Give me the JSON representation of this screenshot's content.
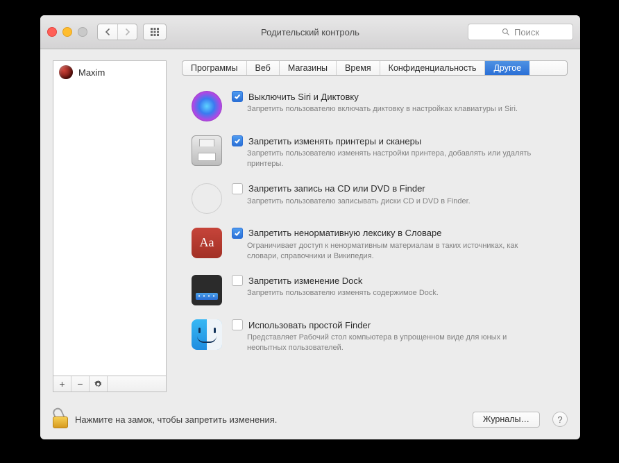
{
  "window": {
    "title": "Родительский контроль"
  },
  "toolbar": {
    "search_placeholder": "Поиск"
  },
  "sidebar": {
    "users": [
      {
        "name": "Maxim"
      }
    ],
    "add_label": "+",
    "remove_label": "−"
  },
  "tabs": {
    "items": [
      {
        "label": "Программы",
        "active": false
      },
      {
        "label": "Веб",
        "active": false
      },
      {
        "label": "Магазины",
        "active": false
      },
      {
        "label": "Время",
        "active": false
      },
      {
        "label": "Конфиденциальность",
        "active": false
      },
      {
        "label": "Другое",
        "active": true
      }
    ]
  },
  "options": [
    {
      "icon": "siri",
      "checked": true,
      "title": "Выключить Siri и Диктовку",
      "desc": "Запретить пользователю включать диктовку в настройках клавиатуры и Siri."
    },
    {
      "icon": "printer",
      "checked": true,
      "title": "Запретить изменять принтеры и сканеры",
      "desc": "Запретить пользователю изменять настройки принтера, добавлять или удалять принтеры."
    },
    {
      "icon": "disc",
      "checked": false,
      "title": "Запретить запись на CD или DVD в Finder",
      "desc": "Запретить пользователю записывать диски CD и DVD в Finder."
    },
    {
      "icon": "dictionary",
      "checked": true,
      "title": "Запретить ненормативную лексику в Словаре",
      "desc": "Ограничивает доступ к ненормативным материалам в таких источниках, как словари, справочники и Википедия."
    },
    {
      "icon": "dock",
      "checked": false,
      "title": "Запретить изменение Dock",
      "desc": "Запретить пользователю изменять содержимое Dock."
    },
    {
      "icon": "finder",
      "checked": false,
      "title": "Использовать простой Finder",
      "desc": "Представляет Рабочий стол компьютера в упрощенном виде для юных и неопытных пользователей."
    }
  ],
  "footer": {
    "lock_text": "Нажмите на замок, чтобы запретить изменения.",
    "logs_button": "Журналы…",
    "help_label": "?"
  },
  "icons": {
    "dictionary_glyph": "Aa"
  }
}
